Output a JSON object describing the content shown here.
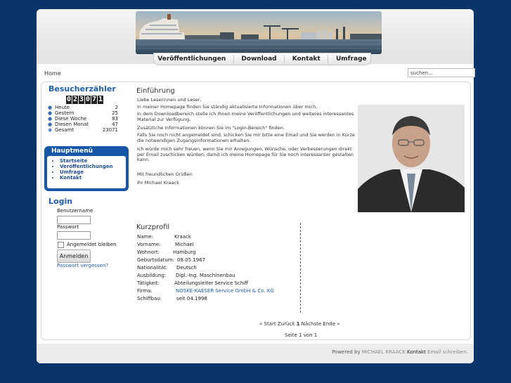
{
  "nav": {
    "items": [
      "Veröffentlichungen",
      "Download",
      "Kontakt",
      "Umfrage"
    ]
  },
  "breadcrumb": "Home",
  "search": {
    "value": "suchen..."
  },
  "counter": {
    "title": "Besucherzähler",
    "digits": [
      "0",
      "2",
      "3",
      "0",
      "7",
      "1"
    ],
    "rows": [
      {
        "icon": "person-icon",
        "label": "Heute",
        "value": "2"
      },
      {
        "icon": "person-icon",
        "label": "Gestern",
        "value": "25"
      },
      {
        "icon": "person-icon",
        "label": "Diese Woche",
        "value": "83"
      },
      {
        "icon": "person-icon",
        "label": "Diesen Monat",
        "value": "47"
      },
      {
        "icon": "people-icon",
        "label": "Gesamt",
        "value": "23071"
      }
    ]
  },
  "menu": {
    "title": "Hauptmenü",
    "items": [
      "Startseite",
      "Veröffentlichungen",
      "Umfrage",
      "Kontakt"
    ]
  },
  "login": {
    "title": "Login",
    "username_label": "Benutzername",
    "password_label": "Passwort",
    "remember_label": "Angemeldet bleiben",
    "submit_label": "Anmelden",
    "forgot_label": "Passwort vergessen?"
  },
  "intro": {
    "title": "Einführung",
    "paragraphs": [
      "Liebe Leserinnen und Leser,",
      "in meiner Homepage finden Sie ständig aktualisierte Informationen über mich.",
      "In dem Downloadbereich stelle ich Ihnen meine Veröffentlichungen und weiteres interessantes Material zur Verfügung.",
      "Zusätzliche Informationen können Sie im \"Login-Bereich\" finden.",
      "Falls Sie noch nicht angemeldet sind, schicken Sie mir bitte eine Email und Sie werden in Kürze die notwendigen Zugangsinformationen erhalten.",
      "Ich würde mich sehr freuen, wenn Sie mir Anregungen, Wünsche, oder Verbesserungen direkt per Email zuschicken würden, damit ich meine Homepage für Sie noch interessanter gestalten kann."
    ],
    "closing": "Mit freundlichen Grüßen",
    "signature": "Ihr Michael Kraack"
  },
  "profile": {
    "title": "Kurzprofil",
    "rows": [
      {
        "label": "Name:",
        "value": "Kraack"
      },
      {
        "label": "Vorname:",
        "value": "Michael"
      },
      {
        "label": "Wohnort:",
        "value": "Hamburg"
      },
      {
        "label": "Geburtsdatum:",
        "value": "08.05.1967"
      },
      {
        "label": "Nationalität:",
        "value": "Deutsch"
      },
      {
        "label": "Ausbildung:",
        "value": "Dipl.-Ing. Maschinenbau"
      },
      {
        "label": "Tätigkeit:",
        "value": "Abteilungsleiter Service Schiff"
      },
      {
        "label": "Firma:",
        "value": "NOSKE-KAESER Service GmbH & Co. KG"
      },
      {
        "label": "Schiffbau:",
        "value": "seit 04.1998"
      }
    ]
  },
  "pagination": {
    "prev_mark": "«",
    "start": "Start",
    "back": "Zurück",
    "current": "1",
    "next": "Nächste",
    "end": "Ende",
    "next_mark": "»",
    "info": "Seite 1 von 1"
  },
  "footer": {
    "powered_by": "Powered by",
    "author": "MICHAEL KRAACK",
    "contact": "Kontakt",
    "email_text": "Email schreiben."
  },
  "colors": {
    "background": "#0b3468",
    "accent": "#1657a8",
    "link": "#1f5fa8"
  }
}
